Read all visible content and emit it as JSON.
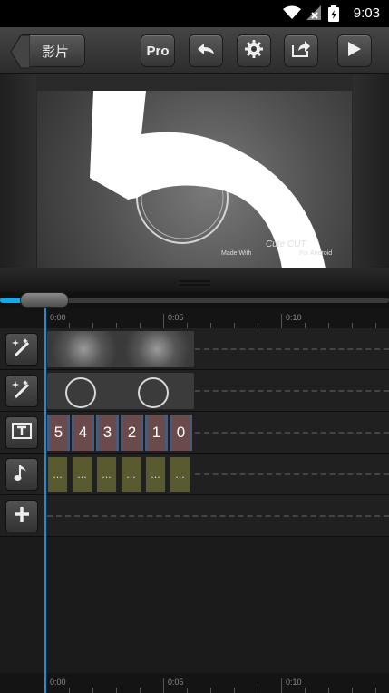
{
  "status_bar": {
    "time": "9:03"
  },
  "toolbar": {
    "back_label": "影片",
    "pro_label": "Pro"
  },
  "preview": {
    "watermark_made_with": "Made With",
    "watermark_brand": "Cute CUT",
    "watermark_for": "For Android",
    "countdown_digit": "5"
  },
  "timeline": {
    "ruler_labels": [
      "0:00",
      "0:05",
      "0:10"
    ],
    "text_track": [
      "5",
      "4",
      "3",
      "2",
      "1",
      "0"
    ],
    "audio_track": [
      "...",
      "...",
      "...",
      "...",
      "...",
      "..."
    ],
    "progress": 0.07
  },
  "colors": {
    "accent": "#1ea5e8",
    "playhead": "#1e8ed0"
  }
}
